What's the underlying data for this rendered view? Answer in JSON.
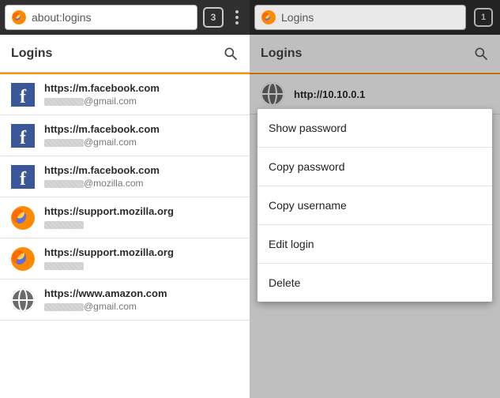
{
  "left": {
    "url": "about:logins",
    "tab_count": "3",
    "section_title": "Logins",
    "items": [
      {
        "icon": "facebook",
        "site": "https://m.facebook.com",
        "user_suffix": "@gmail.com"
      },
      {
        "icon": "facebook",
        "site": "https://m.facebook.com",
        "user_suffix": "@gmail.com"
      },
      {
        "icon": "facebook",
        "site": "https://m.facebook.com",
        "user_suffix": "@mozilla.com"
      },
      {
        "icon": "firefox",
        "site": "https://support.mozilla.org",
        "user_suffix": ""
      },
      {
        "icon": "firefox",
        "site": "https://support.mozilla.org",
        "user_suffix": ""
      },
      {
        "icon": "globe",
        "site": "https://www.amazon.com",
        "user_suffix": "@gmail.com"
      }
    ]
  },
  "right": {
    "url": "Logins",
    "tab_count": "1",
    "section_title": "Logins",
    "items": [
      {
        "icon": "globe",
        "site": "http://10.10.0.1",
        "user_suffix": ""
      }
    ],
    "menu": [
      "Show password",
      "Copy password",
      "Copy username",
      "Edit login",
      "Delete"
    ]
  }
}
